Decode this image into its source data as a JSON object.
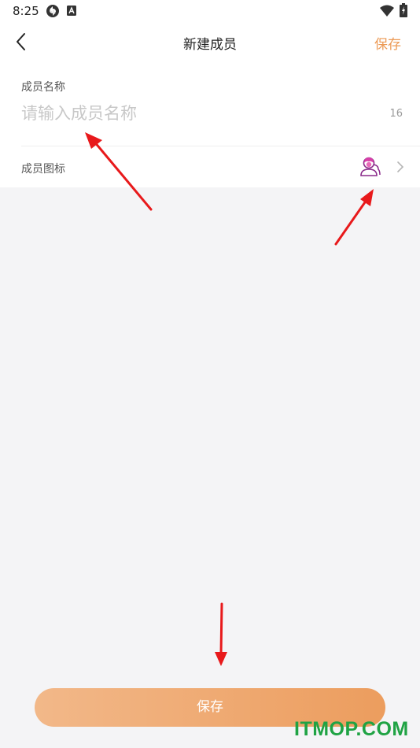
{
  "status_bar": {
    "time": "8:25"
  },
  "nav": {
    "title": "新建成员",
    "save_label": "保存"
  },
  "form": {
    "name_label": "成员名称",
    "name_placeholder": "请输入成员名称",
    "name_value": "",
    "name_max_length": "16",
    "icon_label": "成员图标",
    "icon_name": "member-avatar-icon"
  },
  "bottom": {
    "save_label": "保存"
  },
  "watermark": "ITMOP.COM",
  "colors": {
    "accent": "#ec9a55",
    "background": "#f4f4f6",
    "annotation_arrow": "#e8191b",
    "watermark": "#1fa344"
  }
}
